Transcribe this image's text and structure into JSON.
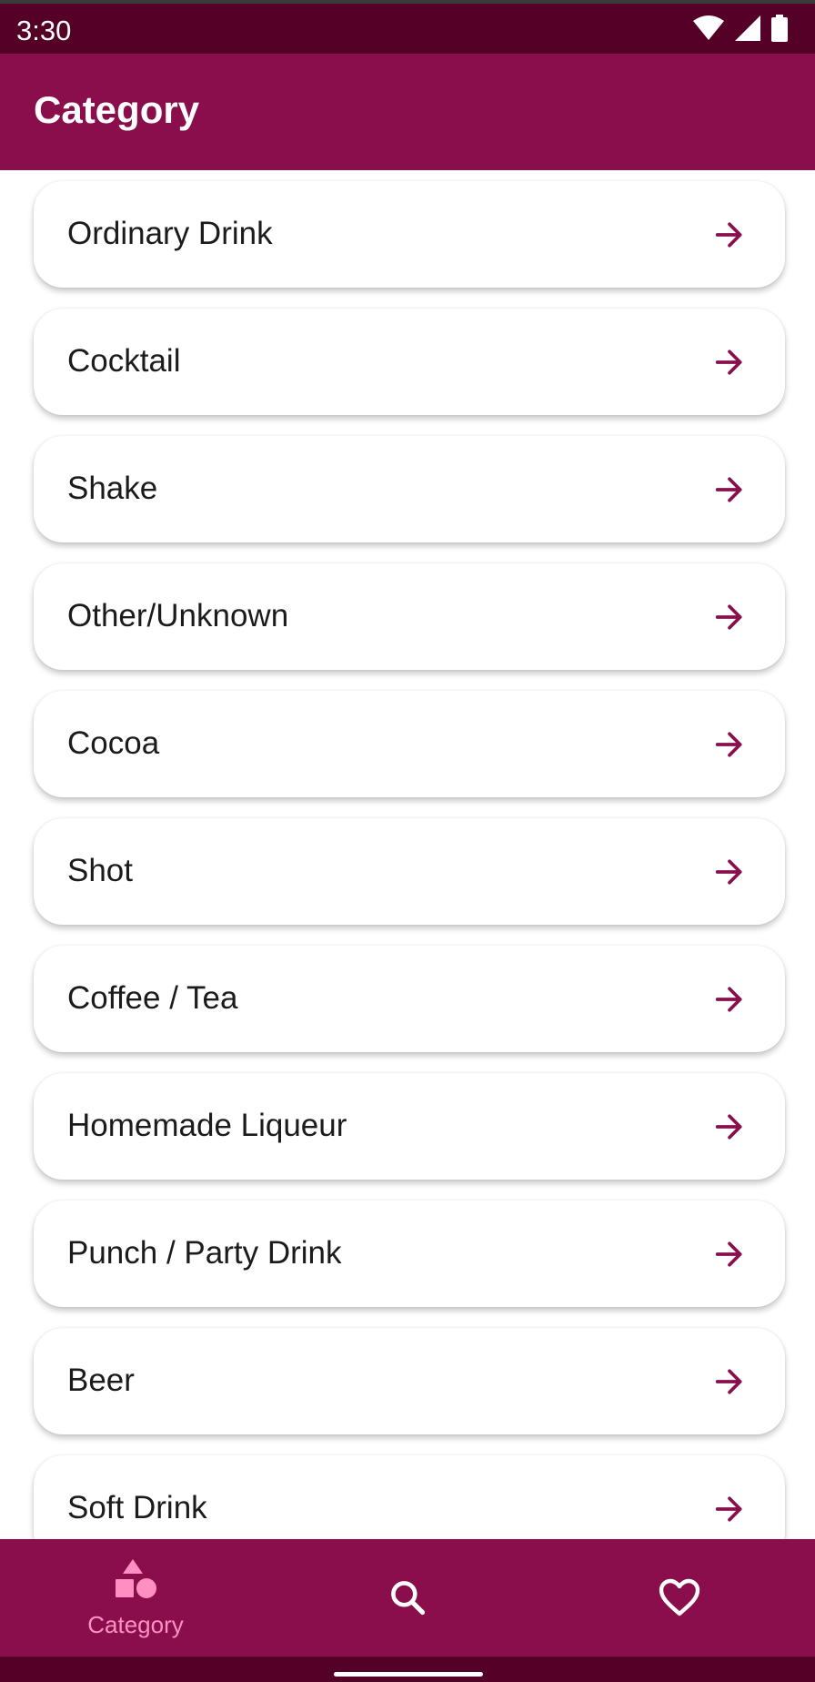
{
  "status_bar": {
    "time": "3:30",
    "icons": [
      "wifi-icon",
      "signal-icon",
      "battery-icon"
    ]
  },
  "app_bar": {
    "title": "Category"
  },
  "categories": [
    {
      "label": "Ordinary Drink"
    },
    {
      "label": "Cocktail"
    },
    {
      "label": "Shake"
    },
    {
      "label": "Other/Unknown"
    },
    {
      "label": "Cocoa"
    },
    {
      "label": "Shot"
    },
    {
      "label": "Coffee / Tea"
    },
    {
      "label": "Homemade Liqueur"
    },
    {
      "label": "Punch / Party Drink"
    },
    {
      "label": "Beer"
    },
    {
      "label": "Soft Drink"
    }
  ],
  "bottom_nav": {
    "items": [
      {
        "label": "Category",
        "icon": "shapes-icon",
        "selected": true
      },
      {
        "label": "",
        "icon": "search-icon",
        "selected": false
      },
      {
        "label": "",
        "icon": "heart-icon",
        "selected": false
      }
    ]
  },
  "colors": {
    "primary": "#890e4b",
    "primary_dark": "#540027",
    "nav_selected": "#ff8fc0",
    "arrow": "#890e4b"
  }
}
